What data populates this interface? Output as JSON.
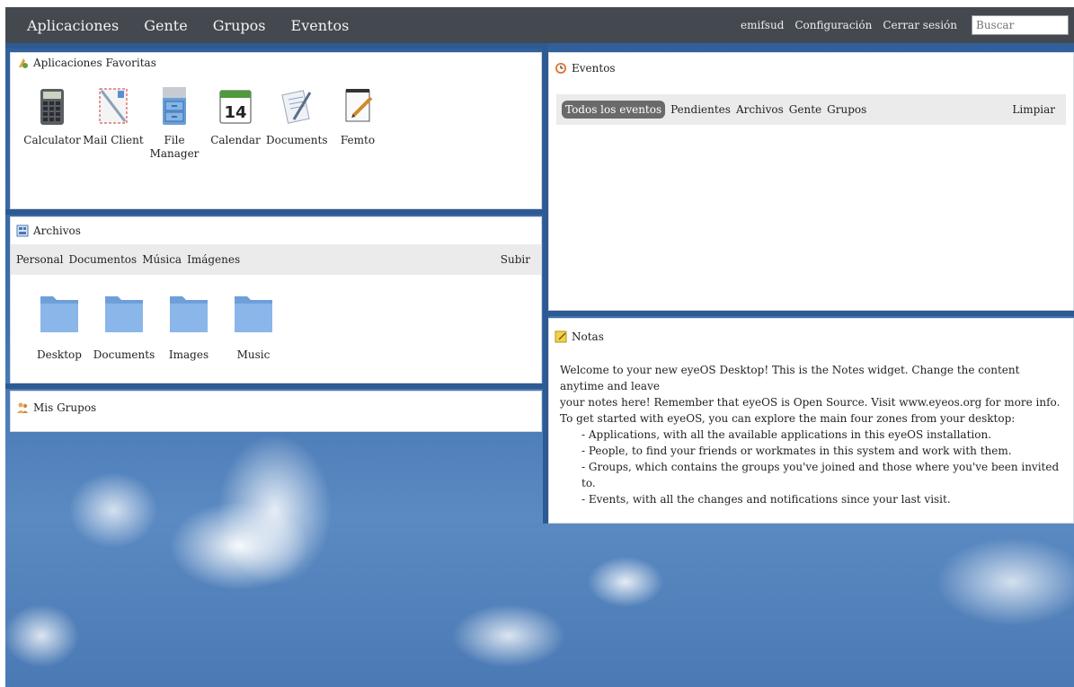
{
  "topbar": {
    "nav": [
      "Aplicaciones",
      "Gente",
      "Grupos",
      "Eventos"
    ],
    "user": "emifsud",
    "settings": "Configuración",
    "logout": "Cerrar sesión",
    "search_placeholder": "Buscar"
  },
  "favorites": {
    "title": "Aplicaciones Favoritas",
    "apps": [
      {
        "label": "Calculator",
        "icon": "calculator-icon"
      },
      {
        "label": "Mail Client",
        "icon": "mail-client-icon"
      },
      {
        "label": "File Manager",
        "icon": "file-manager-icon"
      },
      {
        "label": "Calendar",
        "icon": "calendar-icon",
        "day": "14"
      },
      {
        "label": "Documents",
        "icon": "documents-icon"
      },
      {
        "label": "Femto",
        "icon": "notepad-icon"
      }
    ]
  },
  "files": {
    "title": "Archivos",
    "tabs": [
      "Personal",
      "Documentos",
      "Música",
      "Imágenes"
    ],
    "upload": "Subir",
    "folders": [
      "Desktop",
      "Documents",
      "Images",
      "Music"
    ]
  },
  "groups": {
    "title": "Mis Grupos"
  },
  "events": {
    "title": "Eventos",
    "tabs": [
      "Todos los eventos",
      "Pendientes",
      "Archivos",
      "Gente",
      "Grupos"
    ],
    "clear": "Limpiar"
  },
  "notes": {
    "title": "Notas",
    "line1": "Welcome to your new eyeOS Desktop! This is the Notes widget. Change the content anytime and leave",
    "line2": "your notes here! Remember that eyeOS is Open Source. Visit www.eyeos.org for more info.",
    "line3": "To get started with eyeOS, you can explore the main four zones from your desktop:",
    "items": [
      "- Applications, with all the available applications in this eyeOS installation.",
      "- People, to find your friends or workmates in this system and work with them.",
      "- Groups, which contains the groups you've joined and those where you've been invited to.",
      "- Events, with all the changes and notifications since your last visit."
    ]
  }
}
